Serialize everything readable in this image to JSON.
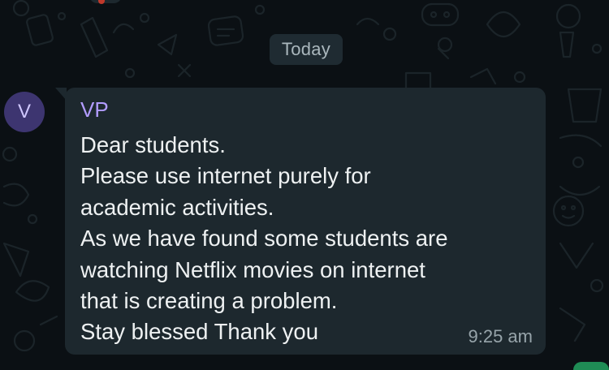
{
  "chat": {
    "date_chip": "Today",
    "avatar_letter": "V",
    "message": {
      "sender": "VP",
      "lines": [
        "Dear students.",
        "Please use internet purely for",
        "academic activities.",
        "As we have found some students are",
        "watching Netflix movies on internet",
        "that is creating a problem.",
        "Stay blessed Thank you"
      ],
      "time": "9:25 am"
    }
  },
  "colors": {
    "background": "#0b1014",
    "bubble": "#1d282e",
    "sender_name": "#b29cff",
    "avatar_bg": "#3d3570",
    "message_text": "#eef1f2",
    "timestamp": "#97a4aa"
  },
  "icons": [
    "wallpaper-doodles",
    "reaction-heart-icon"
  ]
}
